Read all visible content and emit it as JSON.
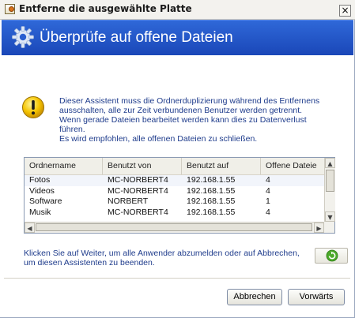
{
  "window": {
    "title": "Entferne die ausgewählte Platte",
    "close_glyph": "×"
  },
  "banner": {
    "title": "Überprüfe auf offene Dateien",
    "icon": "gear-icon"
  },
  "message": {
    "icon": "warning-icon",
    "lines": [
      "Dieser Assistent muss die Ordnerduplizierung während des Entfernens",
      "ausschalten, alle zur Zeit verbundenen Benutzer werden getrennt.",
      "Wenn gerade Dateien bearbeitet werden kann dies zu Datenverlust",
      "führen.",
      "Es wird empfohlen, alle offenen Dateien zu schließen."
    ]
  },
  "table": {
    "columns": [
      "Ordnername",
      "Benutzt von",
      "Benutzt auf",
      "Offene Dateie"
    ],
    "rows": [
      [
        "Fotos",
        "MC-NORBERT4",
        "192.168.1.55",
        "4"
      ],
      [
        "Videos",
        "MC-NORBERT4",
        "192.168.1.55",
        "4"
      ],
      [
        "Software",
        "NORBERT",
        "192.168.1.55",
        "1"
      ],
      [
        "Musik",
        "MC-NORBERT4",
        "192.168.1.55",
        "4"
      ]
    ]
  },
  "footer": {
    "lines": [
      "Klicken Sie auf Weiter, um alle Anwender abzumelden oder auf Abbrechen,",
      "um diesen Assistenten zu beenden."
    ],
    "refresh_icon": "refresh-icon"
  },
  "buttons": {
    "cancel": "Abbrechen",
    "next": "Vorwärts"
  },
  "colors": {
    "banner": "#2a5fd0",
    "message_text": "#1f3c8c",
    "warning": "#f5c400"
  }
}
